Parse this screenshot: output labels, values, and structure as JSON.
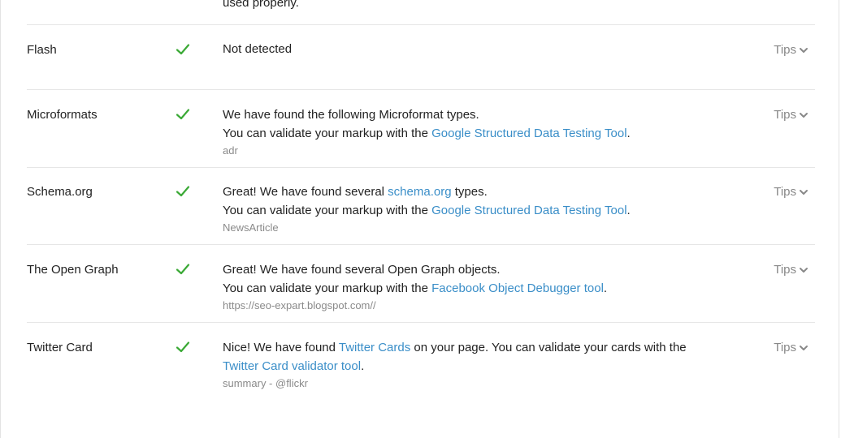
{
  "top_fragment": "used properly.",
  "tips_label": "Tips",
  "rows": [
    {
      "label": "Flash",
      "line1": "Not detected"
    },
    {
      "label": "Microformats",
      "line1": "We have found the following Microformat types.",
      "line2_prefix": "You can validate your markup with the ",
      "line2_link": "Google Structured Data Testing Tool",
      "line2_suffix": ".",
      "sub": "adr"
    },
    {
      "label": "Schema.org",
      "line1_prefix": "Great! We have found several ",
      "line1_link": "schema.org",
      "line1_suffix": " types.",
      "line2_prefix": "You can validate your markup with the ",
      "line2_link": "Google Structured Data Testing Tool",
      "line2_suffix": ".",
      "sub": "NewsArticle"
    },
    {
      "label": "The Open Graph",
      "line1": "Great! We have found several Open Graph objects.",
      "line2_prefix": "You can validate your markup with the ",
      "line2_link": "Facebook Object Debugger tool",
      "line2_suffix": ".",
      "sub": "https://seo-expart.blogspot.com//"
    },
    {
      "label": "Twitter Card",
      "line1_prefix": "Nice! We have found ",
      "line1_link": "Twitter Cards",
      "line1_suffix": " on your page. You can validate your cards with the",
      "line2_link": "Twitter Card validator tool",
      "line2_suffix": ".",
      "sub": "summary - @flickr"
    }
  ],
  "colors": {
    "check": "#3aa935",
    "link": "#3a8ec8",
    "muted": "#8a8a8a",
    "divider": "#e6e6e6"
  },
  "icons": {
    "status": "check-icon",
    "tips": "chevron-down-icon"
  }
}
